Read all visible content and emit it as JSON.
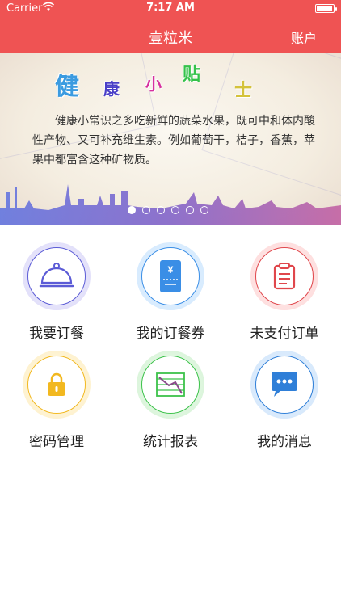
{
  "status_bar": {
    "carrier": "Carrier",
    "time": "7:17 AM"
  },
  "nav": {
    "title": "壹粒米",
    "right_label": "账户"
  },
  "banner": {
    "heading_chars": [
      "健",
      "康",
      "小",
      "贴",
      "士"
    ],
    "body": "健康小常识之多吃新鲜的蔬菜水果，既可中和体内酸性产物、又可补充维生素。例如葡萄干，桔子，香蕉，苹果中都富含这种矿物质。",
    "page_count": 6,
    "current_page": 1
  },
  "menu": [
    {
      "label": "我要订餐",
      "icon": "cloche-icon",
      "color": "#5b5bd6"
    },
    {
      "label": "我的订餐券",
      "icon": "ticket-yen-icon",
      "color": "#3a8ee6"
    },
    {
      "label": "未支付订单",
      "icon": "clipboard-icon",
      "color": "#e0474c"
    },
    {
      "label": "密码管理",
      "icon": "lock-icon",
      "color": "#f2b81f"
    },
    {
      "label": "统计报表",
      "icon": "chart-report-icon",
      "color": "#3cc24a"
    },
    {
      "label": "我的消息",
      "icon": "chat-bubble-icon",
      "color": "#2f7fd8"
    }
  ],
  "colors": {
    "header": "#ef5353"
  }
}
